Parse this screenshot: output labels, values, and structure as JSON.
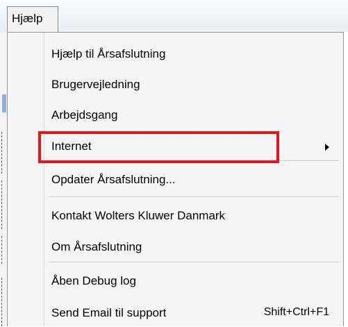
{
  "menu": {
    "title": "Hjælp"
  },
  "items": [
    {
      "label": "Hjælp til Årsafslutning"
    },
    {
      "label": "Brugervejledning"
    },
    {
      "label": "Arbejdsgang"
    },
    {
      "label": "Internet",
      "submenu": true
    },
    {
      "label": "Opdater Årsafslutning..."
    },
    {
      "label": "Kontakt Wolters Kluwer Danmark"
    },
    {
      "label": "Om Årsafslutning"
    },
    {
      "label": "Åben Debug log"
    },
    {
      "label": "Send Email til support",
      "shortcut": "Shift+Ctrl+F1"
    }
  ],
  "highlight_color": "#e8141b"
}
